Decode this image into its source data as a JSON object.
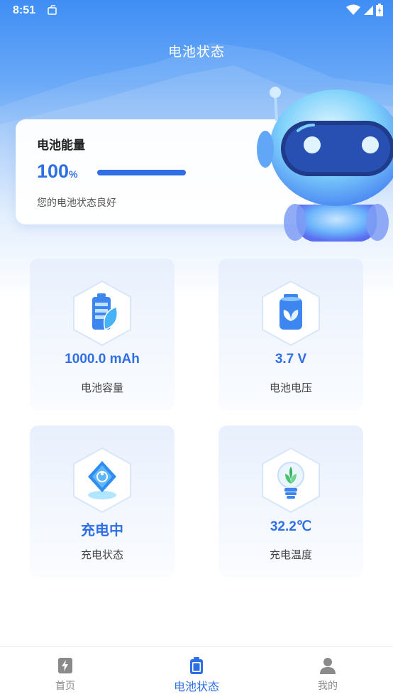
{
  "status_bar": {
    "time": "8:51"
  },
  "header": {
    "title": "电池状态"
  },
  "energy_card": {
    "label": "电池能量",
    "value": "100",
    "unit": "%",
    "level_percent": 100,
    "description": "您的电池状态良好"
  },
  "tiles": [
    {
      "value": "1000.0 mAh",
      "label": "电池容量",
      "icon": "battery-leaf-icon"
    },
    {
      "value": "3.7 V",
      "label": "电池电压",
      "icon": "eco-battery-icon"
    },
    {
      "value": "充电中",
      "label": "充电状态",
      "icon": "charging-plug-icon"
    },
    {
      "value": "32.2℃",
      "label": "充电温度",
      "icon": "plant-bulb-icon"
    }
  ],
  "bottom_nav": {
    "items": [
      {
        "label": "首页",
        "icon": "home-bolt-icon",
        "active": false
      },
      {
        "label": "电池状态",
        "icon": "battery-icon",
        "active": true
      },
      {
        "label": "我的",
        "icon": "profile-icon",
        "active": false
      }
    ]
  },
  "colors": {
    "accent": "#2f6fe6",
    "header_blue": "#3f8ef5",
    "tile_bg": "#e8f0fd"
  }
}
